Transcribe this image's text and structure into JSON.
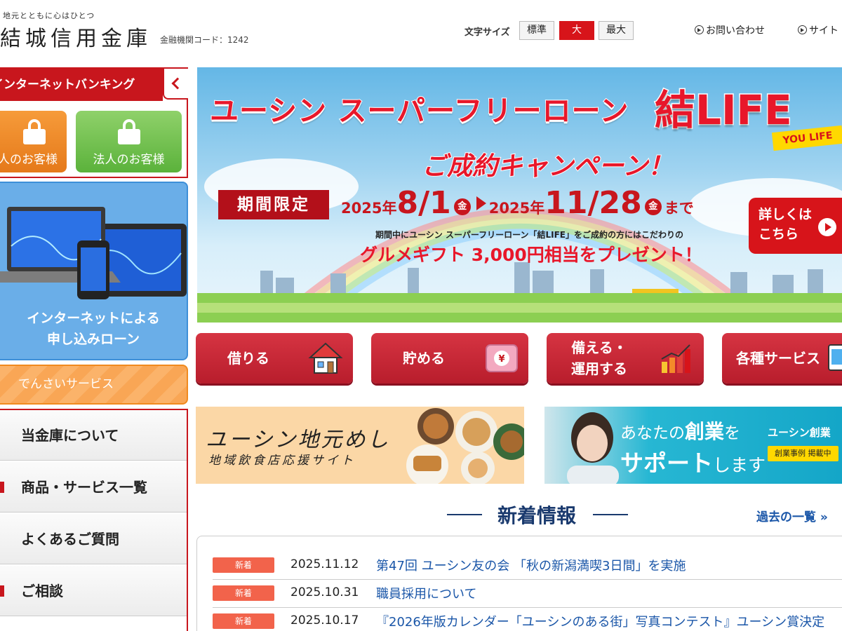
{
  "header": {
    "logo_sub": "地元とともに心はひとつ",
    "logo_main": "結城信用金庫",
    "fi_code": "金融機関コード：1242",
    "font_size_label": "文字サイズ",
    "font_sizes": [
      "標準",
      "大",
      "最大"
    ],
    "font_size_selected": "大",
    "links": [
      "お問い合わせ",
      "サイト"
    ]
  },
  "sidebar": {
    "ib_title": "インターネットバンキング",
    "login_personal": "個人のお客様",
    "login_corporate": "法人のお客様",
    "loan_line1": "インターネットによる",
    "loan_line2": "申し込みローン",
    "denshi": "でんさいサービス",
    "nav": [
      "当金庫について",
      "商品・サービス一覧",
      "よくあるご質問",
      "ご相談"
    ]
  },
  "banner": {
    "title": "ユーシン スーパーフリーローン",
    "brand": "結LIFE",
    "brand_sub": "YOU LIFE",
    "campaign": "ご成約キャンペーン！",
    "limited": "期間限定",
    "date_from_year": "2025年",
    "date_from": "8/1",
    "date_from_dow": "金",
    "date_to_year": "2025年",
    "date_to": "11/28",
    "date_to_dow": "金",
    "date_until": "まで",
    "desc": "期間中にユーシン スーパーフリーローン「結LIFE」をご成約の方にはこだわりの",
    "gift": "グルメギフト 3,000円相当をプレゼント！",
    "more_line1": "詳しくは",
    "more_line2": "こちら"
  },
  "categories": [
    {
      "line1": "借りる",
      "line2": "",
      "icon": "house-icon"
    },
    {
      "line1": "貯める",
      "line2": "",
      "icon": "wallet-icon"
    },
    {
      "line1": "備える・",
      "line2": "運用する",
      "icon": "chart-icon"
    },
    {
      "line1": "各種サービス",
      "line2": "",
      "icon": "device-icon"
    }
  ],
  "promos": {
    "meshi_title": "ユーシン地元めし",
    "meshi_sub": "地域飲食店応援サイト",
    "startup_line1": "あなたの",
    "startup_line1_b": "創業",
    "startup_line1_c": "を",
    "startup_line2": "サポート",
    "startup_line2_b": "します",
    "startup_brand": "ユーシン創業",
    "startup_tag": "創業事例 掲載中"
  },
  "news": {
    "title": "新着情報",
    "past": "過去の一覧 »",
    "items": [
      {
        "badge": "新着",
        "date": "2025.11.12",
        "text": "第47回 ユーシン友の会 「秋の新潟満喫3日間」を実施"
      },
      {
        "badge": "新着",
        "date": "2025.10.31",
        "text": "職員採用について"
      },
      {
        "badge": "新着",
        "date": "2025.10.17",
        "text": "『2026年版カレンダー「ユーシンのある街」写真コンテスト』ユーシン賞決定"
      }
    ]
  },
  "colors": {
    "brand_red": "#c8161d",
    "navy": "#1a3a6e",
    "link_blue": "#1a56a8",
    "badge": "#f2634b"
  }
}
